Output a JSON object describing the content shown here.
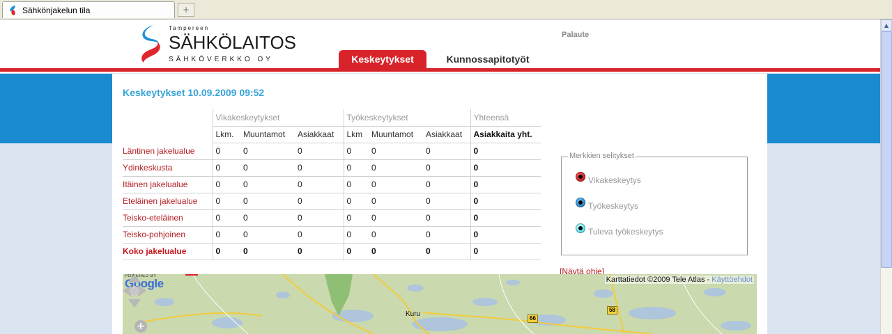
{
  "browser": {
    "tab_title": "Sähkönjakelun tila",
    "new_tab_symbol": "+"
  },
  "header": {
    "logo": {
      "small": "Tampereen",
      "main": "SÄHKÖLAITOS",
      "sub": "SÄHKÖVERKKO OY"
    },
    "feedback_label": "Palaute",
    "nav": {
      "active_tab": "Keskeytykset",
      "inactive_tab": "Kunnossapitotyöt"
    }
  },
  "main": {
    "title": "Keskeytykset 10.09.2009 09:52",
    "table": {
      "groups": {
        "fault": "Vikakeskeytykset",
        "work": "Työkeskeytykset",
        "total": "Yhteensä"
      },
      "subheaders": [
        "Lkm.",
        "Muuntamot",
        "Asiakkaat",
        "Lkm",
        "Muuntamot",
        "Asiakkaat",
        "Asiakkaita yht."
      ],
      "rows": [
        {
          "name": "Läntinen jakelualue",
          "values": [
            "0",
            "0",
            "0",
            "0",
            "0",
            "0",
            "0"
          ]
        },
        {
          "name": "Ydinkeskusta",
          "values": [
            "0",
            "0",
            "0",
            "0",
            "0",
            "0",
            "0"
          ]
        },
        {
          "name": "Itäinen jakelualue",
          "values": [
            "0",
            "0",
            "0",
            "0",
            "0",
            "0",
            "0"
          ]
        },
        {
          "name": "Eteläinen jakelualue",
          "values": [
            "0",
            "0",
            "0",
            "0",
            "0",
            "0",
            "0"
          ]
        },
        {
          "name": "Teisko-eteläinen",
          "values": [
            "0",
            "0",
            "0",
            "0",
            "0",
            "0",
            "0"
          ]
        },
        {
          "name": "Teisko-pohjoinen",
          "values": [
            "0",
            "0",
            "0",
            "0",
            "0",
            "0",
            "0"
          ]
        }
      ],
      "summary": {
        "name": "Koko jakelualue",
        "values": [
          "0",
          "0",
          "0",
          "0",
          "0",
          "0",
          "0"
        ]
      }
    },
    "legend": {
      "title": "Merkkien selitykset",
      "items": [
        "Vikakeskeytys",
        "Työkeskeytys",
        "Tuleva työkeskeytys"
      ]
    },
    "help": {
      "open": "[",
      "label": "Näytä ohje",
      "close": "]"
    },
    "map": {
      "copyright": "Karttatiedot ©2009 Tele Atlas -",
      "terms_link": "Käyttöehdot",
      "powered_by": "POWERED BY",
      "google": "Google",
      "zoom_in": "+",
      "place_label": "Kuru",
      "road_66": "66",
      "road_58": "58"
    }
  }
}
